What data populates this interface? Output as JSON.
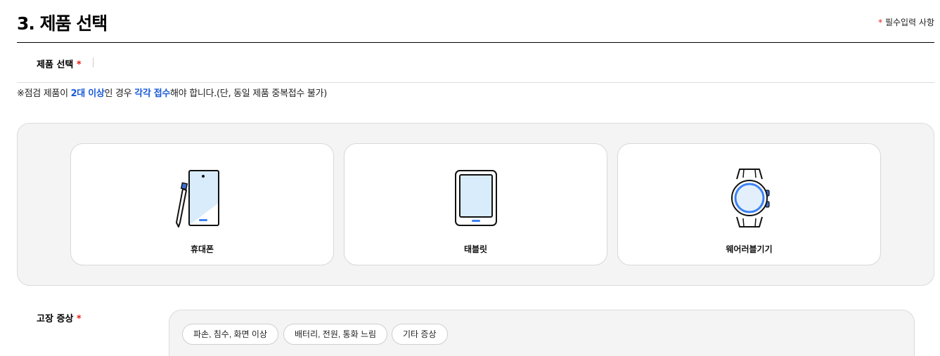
{
  "header": {
    "title": "3. 제품 선택",
    "required_mark": "*",
    "required_text": " 필수입력 사항"
  },
  "product_field": {
    "label": "제품 선택",
    "required_mark": "*"
  },
  "notice": {
    "prefix": "※점검 제품이 ",
    "highlight_1": "2대 이상",
    "middle": "인 경우 ",
    "highlight_2": "각각 접수",
    "suffix": "해야 합니다.(단, 동일 제품 중복접수 불가)"
  },
  "products": [
    {
      "label": "휴대폰",
      "icon": "phone-with-pen-icon"
    },
    {
      "label": "태블릿",
      "icon": "tablet-icon"
    },
    {
      "label": "웨어러블기기",
      "icon": "smartwatch-icon"
    }
  ],
  "symptom_field": {
    "label": "고장 증상",
    "required_mark": "*",
    "options": [
      "파손, 침수, 화면 이상",
      "배터리, 전원, 통화 느림",
      "기타 증상"
    ]
  },
  "colors": {
    "accent_blue": "#1a5bd8",
    "required_red": "#e2231a",
    "panel_bg": "#f4f4f4",
    "icon_fill": "#d9ecfb",
    "icon_accent": "#3b82f6"
  }
}
